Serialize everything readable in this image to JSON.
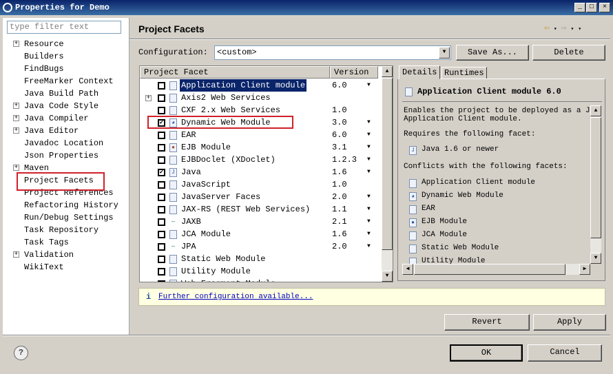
{
  "window": {
    "title": "Properties for Demo",
    "controls": [
      "_",
      "□",
      "×"
    ]
  },
  "filter": {
    "placeholder": "type filter text"
  },
  "tree": [
    {
      "label": "Resource",
      "expandable": true
    },
    {
      "label": "Builders"
    },
    {
      "label": "FindBugs"
    },
    {
      "label": "FreeMarker Context"
    },
    {
      "label": "Java Build Path"
    },
    {
      "label": "Java Code Style",
      "expandable": true
    },
    {
      "label": "Java Compiler",
      "expandable": true
    },
    {
      "label": "Java Editor",
      "expandable": true
    },
    {
      "label": "Javadoc Location"
    },
    {
      "label": "Json Properties"
    },
    {
      "label": "Maven",
      "expandable": true
    },
    {
      "label": "Project Facets",
      "selected": true
    },
    {
      "label": "Project References"
    },
    {
      "label": "Refactoring History"
    },
    {
      "label": "Run/Debug Settings"
    },
    {
      "label": "Task Repository"
    },
    {
      "label": "Task Tags"
    },
    {
      "label": "Validation",
      "expandable": true
    },
    {
      "label": "WikiText"
    }
  ],
  "page": {
    "title": "Project Facets",
    "nav": [
      "⇦",
      "▾",
      "⇨",
      "▾",
      "▾"
    ]
  },
  "config": {
    "label": "Configuration:",
    "value": "<custom>",
    "save_as": "Save As...",
    "delete": "Delete"
  },
  "table": {
    "headers": [
      "Project Facet",
      "Version"
    ],
    "rows": [
      {
        "name": "Application Client module",
        "version": "6.0",
        "checked": false,
        "dropdown": true,
        "selected": true,
        "icon": "page"
      },
      {
        "name": "Axis2 Web Services",
        "version": "",
        "checked": false,
        "expandable": true,
        "icon": "page"
      },
      {
        "name": "CXF 2.x Web Services",
        "version": "1.0",
        "checked": false,
        "icon": "page"
      },
      {
        "name": "Dynamic Web Module",
        "version": "3.0",
        "checked": true,
        "dropdown": true,
        "icon": "globe"
      },
      {
        "name": "EAR",
        "version": "6.0",
        "checked": false,
        "dropdown": true,
        "icon": "page"
      },
      {
        "name": "EJB Module",
        "version": "3.1",
        "checked": false,
        "dropdown": true,
        "icon": "bean"
      },
      {
        "name": "EJBDoclet (XDoclet)",
        "version": "1.2.3",
        "checked": false,
        "dropdown": true,
        "icon": "page"
      },
      {
        "name": "Java",
        "version": "1.6",
        "checked": true,
        "dropdown": true,
        "icon": "java"
      },
      {
        "name": "JavaScript",
        "version": "1.0",
        "checked": false,
        "icon": "page"
      },
      {
        "name": "JavaServer Faces",
        "version": "2.0",
        "checked": false,
        "dropdown": true,
        "icon": "page"
      },
      {
        "name": "JAX-RS (REST Web Services)",
        "version": "1.1",
        "checked": false,
        "dropdown": true,
        "icon": "page"
      },
      {
        "name": "JAXB",
        "version": "2.1",
        "checked": false,
        "dropdown": true,
        "icon": "arrows"
      },
      {
        "name": "JCA Module",
        "version": "1.6",
        "checked": false,
        "dropdown": true,
        "icon": "page"
      },
      {
        "name": "JPA",
        "version": "2.0",
        "checked": false,
        "dropdown": true,
        "icon": "arrows"
      },
      {
        "name": "Static Web Module",
        "version": "",
        "checked": false,
        "icon": "page"
      },
      {
        "name": "Utility Module",
        "version": "",
        "checked": false,
        "icon": "page"
      },
      {
        "name": "Web Fragment Module",
        "version": "",
        "checked": false,
        "icon": "page"
      }
    ]
  },
  "details": {
    "tabs": [
      "Details",
      "Runtimes"
    ],
    "title": "Application Client module 6.0",
    "description": [
      "Enables the project to be deployed as a Java E",
      "Application Client module."
    ],
    "requires_label": "Requires the following facet:",
    "requires": [
      "Java 1.6 or newer"
    ],
    "conflicts_label": "Conflicts with the following facets:",
    "conflicts": [
      "Application Client module",
      "Dynamic Web Module",
      "EAR",
      "EJB Module",
      "JCA Module",
      "Static Web Module",
      "Utility Module"
    ]
  },
  "info": {
    "link": "Further configuration available..."
  },
  "buttons": {
    "revert": "Revert",
    "apply": "Apply",
    "ok": "OK",
    "cancel": "Cancel"
  },
  "colors": {
    "selection": "#0a246a",
    "highlight_box": "#d0202a",
    "info_bg": "#ffffe1"
  }
}
